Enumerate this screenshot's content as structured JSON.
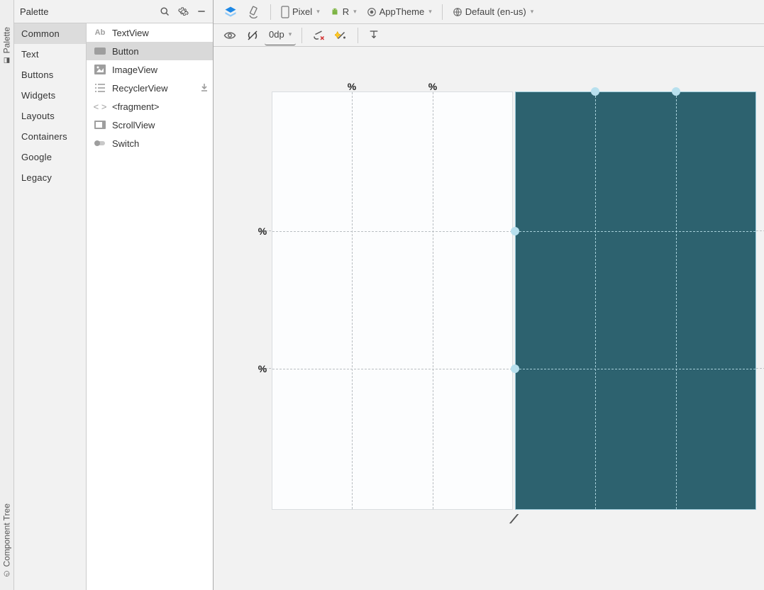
{
  "vert_tabs": {
    "palette": "Palette",
    "component_tree": "Component Tree"
  },
  "palette": {
    "title": "Palette",
    "categories": [
      "Common",
      "Text",
      "Buttons",
      "Widgets",
      "Layouts",
      "Containers",
      "Google",
      "Legacy"
    ],
    "components": [
      "TextView",
      "Button",
      "ImageView",
      "RecyclerView",
      "<fragment>",
      "ScrollView",
      "Switch"
    ],
    "selected_category_index": 0,
    "selected_component_index": 1
  },
  "toolbar1": {
    "device": "Pixel",
    "api": "R",
    "theme": "AppTheme",
    "locale": "Default (en-us)"
  },
  "toolbar2": {
    "spacing": "0dp"
  },
  "canvas": {
    "pct_symbol": "%",
    "guidelines": {
      "vertical_positions": [
        112,
        226
      ],
      "horizontal_positions": [
        196,
        390
      ]
    },
    "colors": {
      "blueprint_bg": "#2d626f",
      "design_bg": "#fcfdfe"
    }
  }
}
